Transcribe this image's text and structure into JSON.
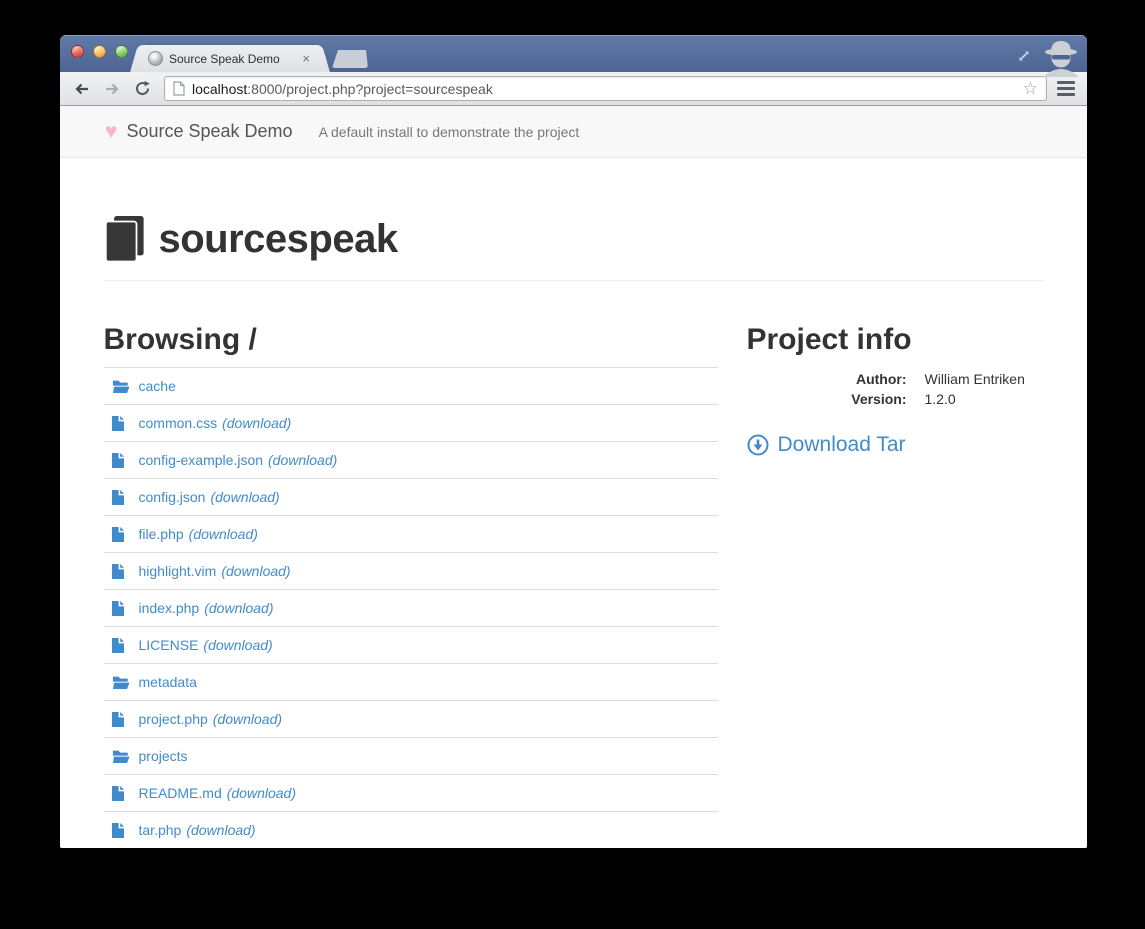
{
  "colors": {
    "link_blue": "#428bca",
    "heart_pink": "#f7b6c4",
    "heading_text": "#333333",
    "navbar_bg": "#f8f8f8",
    "titlebar_blue": "#52699a"
  },
  "browser": {
    "tab_title": "Source Speak Demo",
    "url": {
      "host": "localhost",
      "rest": ":8000/project.php?project=sourcespeak"
    }
  },
  "icons": {
    "heart": "♥",
    "tab_close": "×",
    "bookmark_star": "☆"
  },
  "site_header": {
    "brand": "Source Speak Demo",
    "tagline": "A default install to demonstrate the project"
  },
  "main": {
    "project_title": "sourcespeak",
    "browsing": {
      "heading": "Browsing /",
      "download_label": "(download)",
      "files": [
        {
          "name": "cache",
          "type": "folder"
        },
        {
          "name": "common.css",
          "type": "file"
        },
        {
          "name": "config-example.json",
          "type": "file"
        },
        {
          "name": "config.json",
          "type": "file"
        },
        {
          "name": "file.php",
          "type": "file"
        },
        {
          "name": "highlight.vim",
          "type": "file"
        },
        {
          "name": "index.php",
          "type": "file"
        },
        {
          "name": "LICENSE",
          "type": "file"
        },
        {
          "name": "metadata",
          "type": "folder"
        },
        {
          "name": "project.php",
          "type": "file"
        },
        {
          "name": "projects",
          "type": "folder"
        },
        {
          "name": "README.md",
          "type": "file"
        },
        {
          "name": "tar.php",
          "type": "file"
        }
      ]
    },
    "project_info": {
      "heading": "Project info",
      "fields": [
        {
          "label": "Author:",
          "value": "William Entriken"
        },
        {
          "label": "Version:",
          "value": "1.2.0"
        }
      ],
      "download_tar_label": "Download Tar"
    }
  }
}
